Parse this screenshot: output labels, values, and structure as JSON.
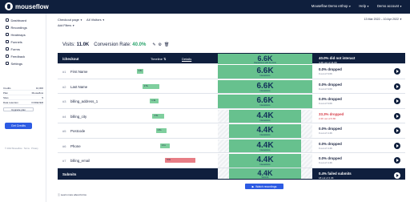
{
  "app": {
    "logo_text": "mouseflow",
    "nav": {
      "website": "Mouseflow Demo eShop",
      "help": "Help",
      "account": "Demo account"
    }
  },
  "sidebar": {
    "items": [
      {
        "label": "Dashboard",
        "icon": "dashboard-icon"
      },
      {
        "label": "Recordings",
        "icon": "recordings-icon"
      },
      {
        "label": "Heatmaps",
        "icon": "heatmaps-icon"
      },
      {
        "label": "Funnels",
        "icon": "funnel-icon"
      },
      {
        "label": "Forms",
        "icon": "forms-icon"
      },
      {
        "label": "Feedback",
        "icon": "feedback-icon"
      },
      {
        "label": "Settings",
        "icon": "settings-icon"
      }
    ],
    "plan": {
      "rows": [
        {
          "k": "Credits",
          "v": "10,000"
        },
        {
          "k": "Plan",
          "v": "Mouseflow"
        },
        {
          "k": "Sites",
          "v": "5"
        },
        {
          "k": "Data retention",
          "v": "FOREVER"
        }
      ],
      "upgrade_label": "Upgrade plan"
    },
    "credits_button": "Get Credits",
    "footer": "© 2022 Mouseflow · Terms · Privacy"
  },
  "header": {
    "page_selector": "Checkout page",
    "visitors_selector": "All Visitors",
    "date_range": "13 Mar 2022 – 10 Apr 2022",
    "add_filters": "Add Filters"
  },
  "stats": {
    "visits_label": "Visits:",
    "visits_value": "11.0K",
    "conversion_label": "Conversion Rate:",
    "conversion_value": "40.0%"
  },
  "funnel": {
    "header": {
      "title": "/checkout",
      "timeline_label": "Timeline",
      "details_label": "Details",
      "visits": "6.6K",
      "visits_sub": "Interactions with the form",
      "drop_title": "40.0% did not interact",
      "drop_sub": "4.4K out of 11.0K"
    },
    "steps": [
      {
        "num": "#1",
        "label": "First Name",
        "tl_start": 0.1,
        "tl_width": 0.03,
        "tl_text": "2.8s",
        "tl_color": "green",
        "visits": "6.6K",
        "visits_sub": "Interactions",
        "drop_title": "0.0% dropped",
        "drop_sub": "0 out of 6.6K",
        "drop_red": false,
        "hatched": false
      },
      {
        "num": "#2",
        "label": "Last Name",
        "tl_start": 0.17,
        "tl_width": 0.2,
        "tl_text": "2.5s",
        "tl_color": "green",
        "visits": "6.6K",
        "visits_sub": "Interactions",
        "drop_title": "0.0% dropped",
        "drop_sub": "0 out of 6.6K",
        "drop_red": false,
        "hatched": false
      },
      {
        "num": "#3",
        "label": "billing_address_1",
        "tl_start": 0.26,
        "tl_width": 0.1,
        "tl_text": "1.3s",
        "tl_color": "green",
        "visits": "6.6K",
        "visits_sub": "Interactions",
        "drop_title": "0.0% dropped",
        "drop_sub": "0 out of 6.6K",
        "drop_red": false,
        "hatched": false
      },
      {
        "num": "#4",
        "label": "billing_city",
        "tl_start": 0.29,
        "tl_width": 0.14,
        "tl_text": "2.5s",
        "tl_color": "green",
        "visits": "4.4K",
        "visits_sub": "Interactions",
        "drop_title": "33.3% dropped",
        "drop_sub": "2.2K out of 6.6K",
        "drop_red": true,
        "hatched": true
      },
      {
        "num": "#5",
        "label": "Postcode",
        "tl_start": 0.33,
        "tl_width": 0.13,
        "tl_text": "2.5s",
        "tl_color": "green",
        "visits": "4.4K",
        "visits_sub": "Interactions",
        "drop_title": "0.0% dropped",
        "drop_sub": "0 out of 4.4K",
        "drop_red": false,
        "hatched": true
      },
      {
        "num": "#6",
        "label": "Phone",
        "tl_start": 0.38,
        "tl_width": 0.12,
        "tl_text": "2.1s",
        "tl_color": "green",
        "visits": "4.4K",
        "visits_sub": "Interactions",
        "drop_title": "0.0% dropped",
        "drop_sub": "0 out of 4.4K",
        "drop_red": false,
        "hatched": true
      },
      {
        "num": "#7",
        "label": "billing_email",
        "tl_start": 0.44,
        "tl_width": 0.36,
        "tl_text": "5.6s",
        "tl_color": "red",
        "visits": "4.4K",
        "visits_sub": "Interactions",
        "drop_title": "0.0% dropped",
        "drop_sub": "0 out of 4.4K",
        "drop_red": false,
        "hatched": true
      }
    ],
    "footer": {
      "label": "Submits",
      "visits": "4.4K",
      "visits_sub": "Submits",
      "drop_title": "0.4% failed submits",
      "drop_sub": "18 out of 4.4K"
    }
  },
  "actions": {
    "watch_label": "Watch recordings",
    "learn_link": "Learn more about forms"
  },
  "colors": {
    "navy": "#0f1f3d",
    "green": "#67c18e",
    "red": "#e77d85",
    "accent": "#2d5be3"
  }
}
